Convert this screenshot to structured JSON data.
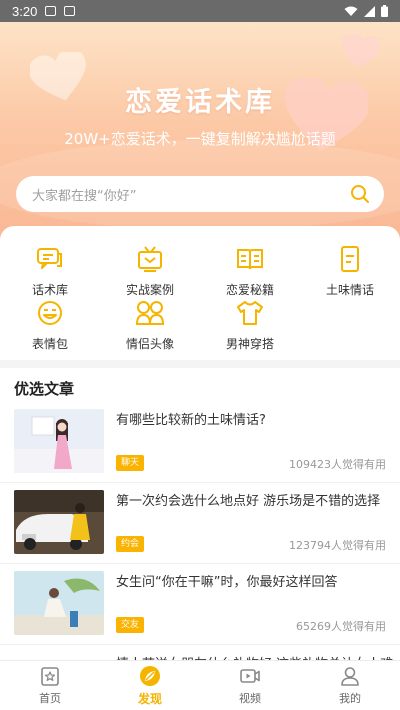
{
  "status_bar": {
    "time": "3:20"
  },
  "hero": {
    "title": "恋爱话术库",
    "subtitle": "20W+恋爱话术，一键复制解决尴尬话题"
  },
  "search": {
    "placeholder": "大家都在搜“你好”"
  },
  "categories": [
    {
      "label": "话术库",
      "icon": "chat-bubbles-icon"
    },
    {
      "label": "实战案例",
      "icon": "tv-icon"
    },
    {
      "label": "恋爱秘籍",
      "icon": "book-icon"
    },
    {
      "label": "土味情话",
      "icon": "note-icon"
    },
    {
      "label": "表情包",
      "icon": "smiley-icon"
    },
    {
      "label": "情侣头像",
      "icon": "couple-icon"
    },
    {
      "label": "男神穿搭",
      "icon": "tshirt-icon"
    }
  ],
  "section": {
    "title": "优选文章"
  },
  "articles": [
    {
      "title": "有哪些比较新的土味情话?",
      "tag": "聊天",
      "likes": "109423人觉得有用"
    },
    {
      "title": "第一次约会选什么地点好 游乐场是不错的选择",
      "tag": "约会",
      "likes": "123794人觉得有用"
    },
    {
      "title": "女生问“你在干嘛”时，你最好这样回答",
      "tag": "交友",
      "likes": "65269人觉得有用"
    }
  ],
  "partial_article": {
    "title": "情人节送女朋友什么礼物好 这些礼物总让女人难"
  },
  "tabbar": {
    "items": [
      {
        "label": "首页",
        "icon": "home-icon",
        "active": false
      },
      {
        "label": "发现",
        "icon": "discover-icon",
        "active": true
      },
      {
        "label": "视频",
        "icon": "video-icon",
        "active": false
      },
      {
        "label": "我的",
        "icon": "profile-icon",
        "active": false
      }
    ]
  },
  "colors": {
    "accent": "#f4b400",
    "hero_top": "#fde3c7",
    "hero_bottom": "#fab794",
    "tag_bg": "#f9b300"
  }
}
